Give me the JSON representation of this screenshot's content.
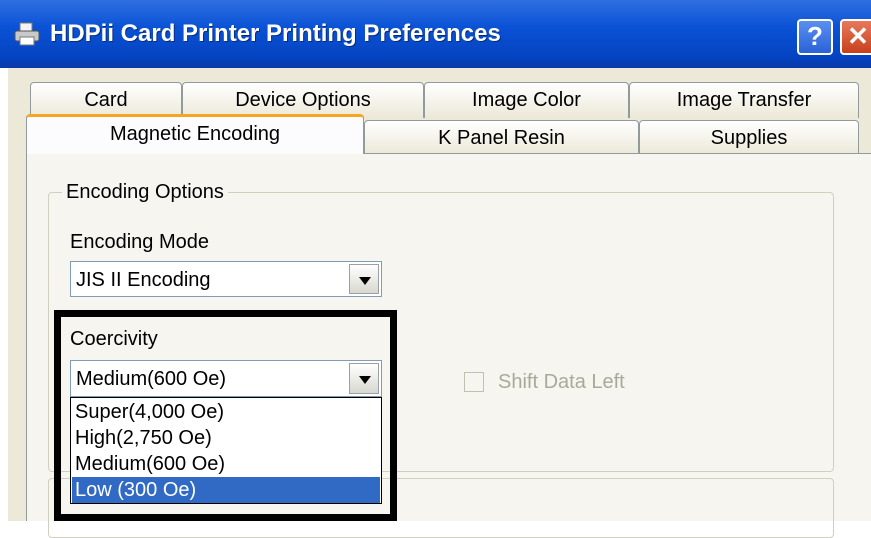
{
  "window": {
    "title": "HDPii Card Printer Printing Preferences",
    "help_label": "?",
    "close_label": "✕",
    "colors": {
      "titlebar": "#0a52d6",
      "close": "#d44a24",
      "selection": "#316ac5"
    }
  },
  "tabs": {
    "row1": [
      "Card",
      "Device Options",
      "Image Color",
      "Image Transfer"
    ],
    "row2": [
      "Magnetic Encoding",
      "K Panel Resin",
      "Supplies"
    ],
    "active": "Magnetic Encoding"
  },
  "encoding_options": {
    "legend": "Encoding Options",
    "mode_label": "Encoding Mode",
    "mode_value": "JIS II Encoding",
    "coercivity_label": "Coercivity",
    "coercivity_value": "Medium(600 Oe)",
    "coercivity_options": [
      "Super(4,000 Oe)",
      "High(2,750 Oe)",
      "Medium(600 Oe)",
      "Low (300 Oe)"
    ],
    "highlighted_option": "Low (300 Oe)",
    "shift_data_left_label": "Shift Data Left",
    "shift_data_left_checked": false
  }
}
